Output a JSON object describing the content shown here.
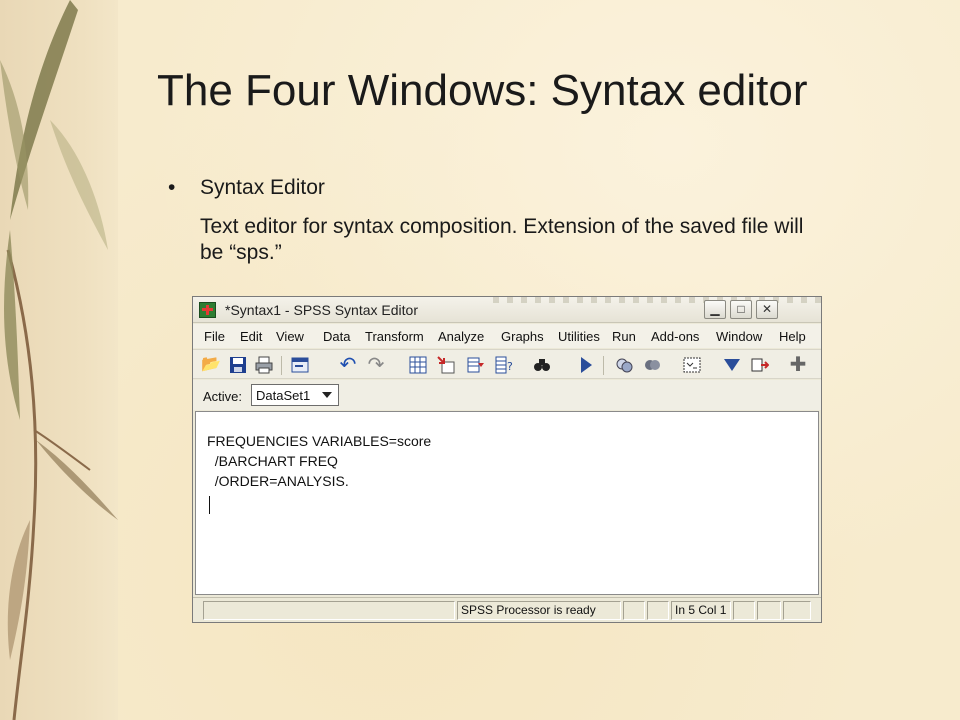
{
  "slide": {
    "title": "The Four Windows: Syntax editor",
    "bullet_marker": "•",
    "bullet_heading": "Syntax Editor",
    "bullet_text": "Text editor for syntax composition. Extension of the saved file will be “sps.”"
  },
  "window": {
    "title": "*Syntax1 - SPSS Syntax Editor",
    "controls": {
      "minimize": "▁",
      "maximize": "□",
      "close": "✕"
    },
    "menu": [
      "File",
      "Edit",
      "View",
      "Data",
      "Transform",
      "Analyze",
      "Graphs",
      "Utilities",
      "Run",
      "Add-ons",
      "Window",
      "Help"
    ],
    "toolbar_icons": [
      "open-folder-icon",
      "save-icon",
      "print-icon",
      "dialog-recall-icon",
      "undo-icon",
      "redo-icon",
      "goto-case-icon",
      "goto-variable-icon",
      "variables-icon",
      "find-icon",
      "run-icon",
      "use-sets-icon",
      "show-all-icon",
      "syntax-help-icon",
      "value-labels-icon",
      "designate-icon",
      "add-icon"
    ],
    "active_label": "Active:",
    "dataset": "DataSet1",
    "syntax": [
      "FREQUENCIES VARIABLES=score",
      "  /BARCHART FREQ",
      "  /ORDER=ANALYSIS."
    ],
    "status": {
      "processor": "SPSS  Processor is ready",
      "position": "In 5 Col 1"
    }
  }
}
